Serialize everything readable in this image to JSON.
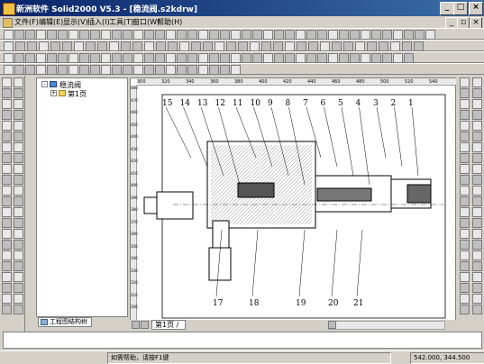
{
  "window": {
    "title": "新洲软件 Solid2000 V5.3 - [稳流阀.s2kdrw]",
    "min_label": "_",
    "max_label": "□",
    "close_label": "×"
  },
  "menu": {
    "items": [
      "文件(F)",
      "编辑(E)",
      "显示(V)",
      "插入(I)",
      "工具(T)",
      "窗口(W)",
      "帮助(H)"
    ],
    "doc_min": "_",
    "doc_restore": "▫",
    "doc_close": "×"
  },
  "tree": {
    "root": "稳流阀",
    "child": "第1页",
    "tab": "工程图结构树"
  },
  "sheet": {
    "tab": "第1页",
    "slash": "/"
  },
  "ruler": {
    "top_ticks": [
      "300",
      "320",
      "340",
      "360",
      "380",
      "400",
      "420",
      "440",
      "460",
      "480",
      "500",
      "520",
      "540"
    ],
    "left_ticks": [
      "480",
      "470",
      "460",
      "450",
      "440",
      "430",
      "420",
      "410",
      "400",
      "390",
      "380",
      "370",
      "360",
      "350",
      "340",
      "330",
      "320",
      "310",
      "300"
    ]
  },
  "drawing": {
    "balloons_top": [
      "15",
      "14",
      "13",
      "12",
      "11",
      "10",
      "9",
      "8",
      "7",
      "6",
      "5",
      "4",
      "3",
      "2",
      "1"
    ],
    "balloons_bottom": [
      "17",
      "18",
      "19",
      "20",
      "21"
    ]
  },
  "status": {
    "help": "如需帮助，请按F1键",
    "coords": "542.000, 344.500"
  },
  "colors": {
    "title_start": "#0a246a",
    "title_end": "#3a6ea5",
    "chrome": "#d4d0c8"
  }
}
